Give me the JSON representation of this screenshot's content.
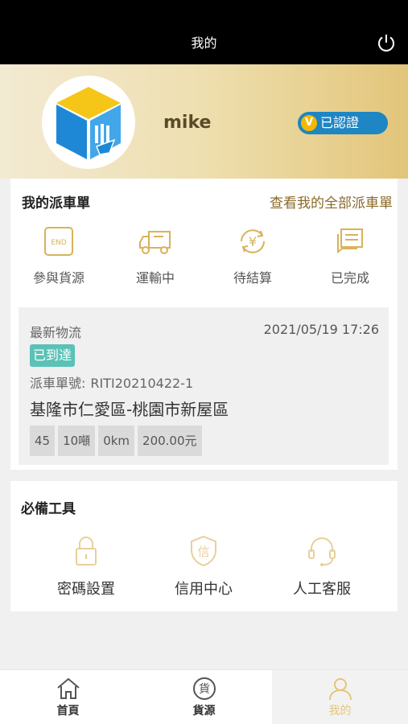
{
  "header": {
    "title": "我的"
  },
  "profile": {
    "username": "mike",
    "verify_mark": "V",
    "verify_label": "已認證"
  },
  "orders": {
    "title": "我的派車單",
    "view_all": "查看我的全部派車單",
    "statuses": [
      {
        "label": "參與貨源",
        "icon": "end-icon",
        "icon_text": "END"
      },
      {
        "label": "運輸中",
        "icon": "truck-icon"
      },
      {
        "label": "待結算",
        "icon": "yen-settlement-icon",
        "icon_text": "¥"
      },
      {
        "label": "已完成",
        "icon": "completed-documents-icon"
      }
    ],
    "latest": {
      "title": "最新物流",
      "datetime": "2021/05/19 17:26",
      "status": "已到達",
      "order_label": "派車單號:",
      "order_no": "RITI20210422-1",
      "route": "基隆市仁愛區-桃園市新屋區",
      "tags": [
        "45",
        "10噸",
        "0km",
        "200.00元"
      ]
    }
  },
  "tools": {
    "title": "必備工具",
    "items": [
      {
        "label": "密碼設置",
        "icon": "lock-icon"
      },
      {
        "label": "信用中心",
        "icon": "credit-shield-icon",
        "icon_text": "信"
      },
      {
        "label": "人工客服",
        "icon": "headset-icon"
      }
    ]
  },
  "tabbar": {
    "tabs": [
      {
        "label": "首頁",
        "icon": "home-icon"
      },
      {
        "label": "貨源",
        "icon": "cargo-icon",
        "icon_text": "貨"
      },
      {
        "label": "我的",
        "icon": "user-icon",
        "active": true
      }
    ]
  },
  "colors": {
    "accent_gold": "#d9b25a",
    "badge_blue": "#1e86c3",
    "arrived_teal": "#5ac2b7",
    "tab_active": "#e6c47a"
  }
}
